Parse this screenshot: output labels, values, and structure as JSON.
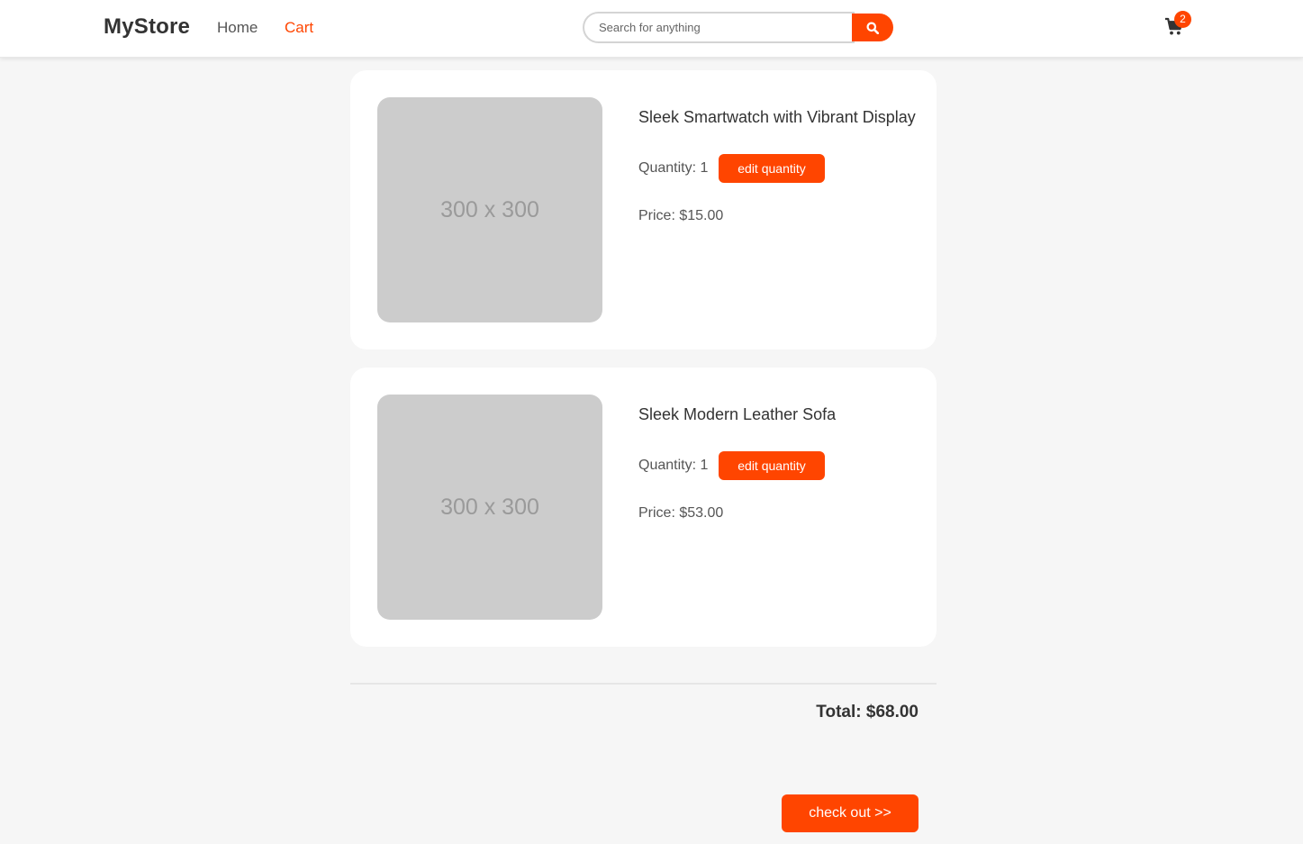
{
  "navbar": {
    "brand": "MyStore",
    "links": [
      {
        "label": "Home",
        "active": false
      },
      {
        "label": "Cart",
        "active": true
      }
    ],
    "search": {
      "placeholder": "Search for anything",
      "value": "",
      "button_icon": "search-icon"
    },
    "cart": {
      "icon": "shopping-cart-icon",
      "badge_count": "2"
    }
  },
  "cart_items": [
    {
      "image_text": "300 x 300",
      "title": "Sleek Smartwatch with Vibrant Display",
      "quantity_label": "Quantity: 1",
      "edit_label": "edit quantity",
      "price_label": "Price: $15.00"
    },
    {
      "image_text": "300 x 300",
      "title": "Sleek Modern Leather Sofa",
      "quantity_label": "Quantity: 1",
      "edit_label": "edit quantity",
      "price_label": "Price: $53.00"
    }
  ],
  "summary": {
    "total_label": "Total: $68.00",
    "checkout_label": "check out >>"
  },
  "colors": {
    "accent": "#ff4500",
    "background": "#f6f6f6",
    "card": "#ffffff",
    "placeholder": "#cccccc"
  }
}
